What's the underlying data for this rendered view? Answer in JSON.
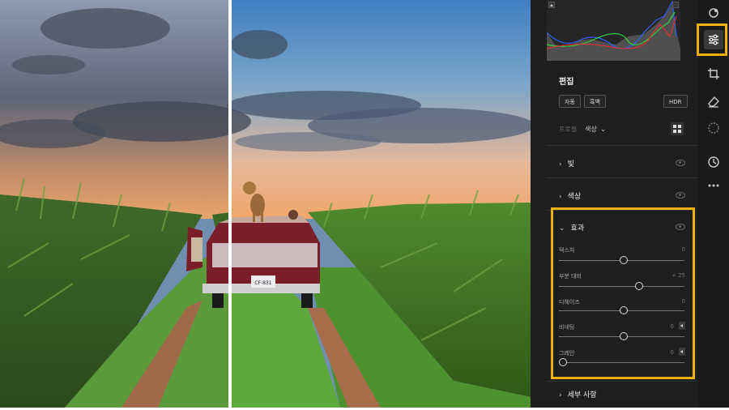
{
  "panel": {
    "edit_title": "편집",
    "buttons": {
      "auto": "자동",
      "bw": "흑백",
      "hdr": "HDR"
    },
    "profile": {
      "label": "프로필",
      "value": "색상"
    },
    "sections": {
      "light": "빛",
      "color": "색상",
      "effects": "효과",
      "detail": "세부 사항"
    },
    "sliders": [
      {
        "label": "텍스처",
        "value": "0"
      },
      {
        "label": "부분 대비",
        "value": "+ 25"
      },
      {
        "label": "디헤이즈",
        "value": "0"
      },
      {
        "label": "비네팅",
        "value": "0"
      },
      {
        "label": "그레인",
        "value": "0"
      }
    ]
  },
  "photo": {
    "license_plate": "CF-831"
  },
  "colors": {
    "highlight": "#f0b000",
    "panel_bg": "#1e1e1e"
  },
  "icons": [
    "heal-icon",
    "sliders-icon",
    "crop-icon",
    "eraser-icon",
    "mask-icon",
    "history-icon",
    "more-icon"
  ]
}
